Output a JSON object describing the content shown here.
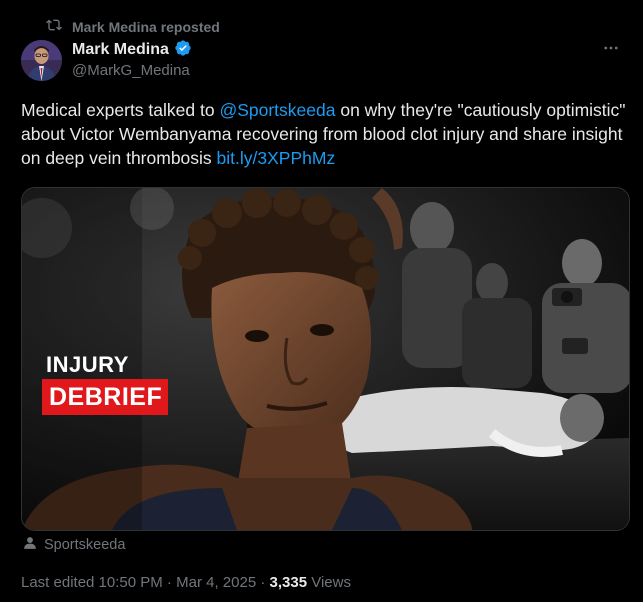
{
  "repost": {
    "text": "Mark Medina reposted"
  },
  "author": {
    "name": "Mark Medina",
    "handle": "@MarkG_Medina",
    "verified": true
  },
  "tweet": {
    "text_1": "Medical experts talked to ",
    "mention": "@Sportskeeda",
    "text_2": " on why they're \"cautiously optimistic\" about Victor Wembanyama recovering from blood clot injury and share insight on deep vein thrombosis ",
    "link": "bit.ly/3XPPhMz"
  },
  "media": {
    "badge_top": "INJURY",
    "badge_bottom": "DEBRIEF"
  },
  "source": {
    "label": "Sportskeeda"
  },
  "meta": {
    "edited": "Last edited 10:50 PM",
    "sep1": " · ",
    "date": "Mar 4, 2025",
    "sep2": " · ",
    "views_count": "3,335",
    "views_label": " Views"
  },
  "colors": {
    "background": "#000000",
    "text": "#e7e9ea",
    "muted": "#71767b",
    "link": "#1d9bf0",
    "verified": "#1d9bf0",
    "badge_red": "#e0181c"
  },
  "icons": {
    "repost": "repost-icon",
    "verified": "verified-badge-icon",
    "more": "more-icon",
    "source": "person-icon"
  }
}
